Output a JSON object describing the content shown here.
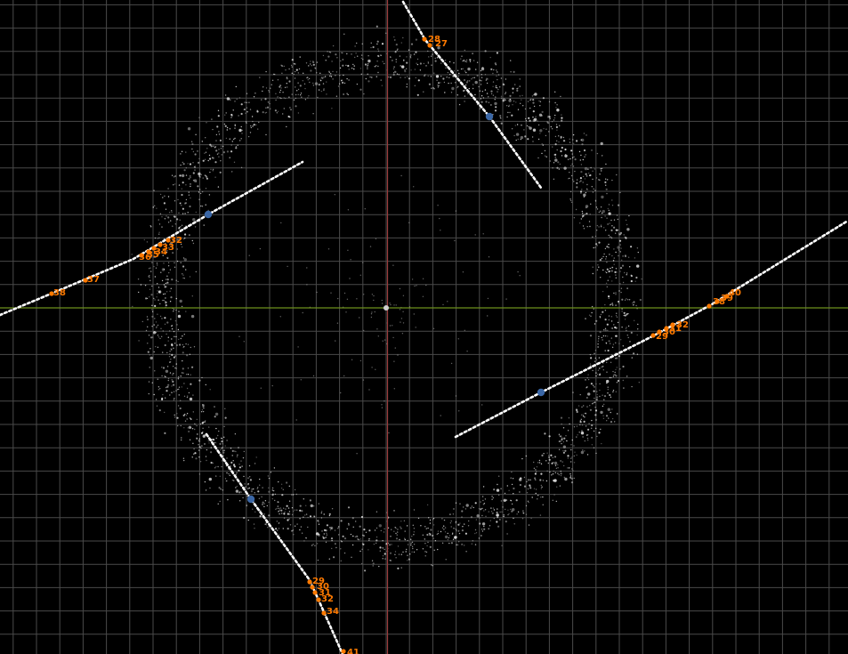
{
  "colors": {
    "background": "#000000",
    "grid": "#4a4a4a",
    "axis_x": "#6e8f1e",
    "axis_y": "#9b3b3b",
    "particles": "#dcdcdc",
    "trajectory": "#ffffff",
    "node": "#3b67a6",
    "marker": "#ff7a00",
    "origin": "#cfcfcf"
  },
  "trajectories": [
    {
      "id": "top-right",
      "node_label": "",
      "markers": [
        {
          "label": "27"
        },
        {
          "label": "28"
        }
      ]
    },
    {
      "id": "left",
      "node_label": "",
      "markers": [
        {
          "label": "32"
        },
        {
          "label": "33"
        },
        {
          "label": "34"
        },
        {
          "label": "35"
        },
        {
          "label": "36"
        },
        {
          "label": "37"
        },
        {
          "label": "38"
        }
      ]
    },
    {
      "id": "right",
      "node_label": "",
      "markers": [
        {
          "label": "29"
        },
        {
          "label": "30"
        },
        {
          "label": "31"
        },
        {
          "label": "32"
        },
        {
          "label": "38"
        },
        {
          "label": "39"
        },
        {
          "label": "40"
        }
      ]
    },
    {
      "id": "bottom",
      "node_label": "",
      "markers": [
        {
          "label": "29"
        },
        {
          "label": "30"
        },
        {
          "label": "31"
        },
        {
          "label": "32"
        },
        {
          "label": "34"
        },
        {
          "label": "41"
        }
      ]
    }
  ]
}
